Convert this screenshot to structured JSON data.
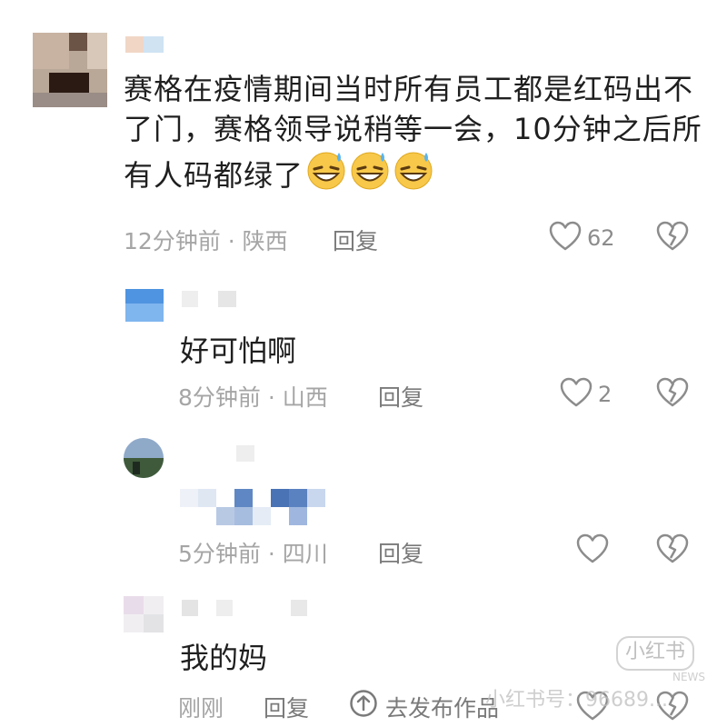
{
  "comments": [
    {
      "text": "赛格在疫情期间当时所有员工都是红码出不了门，赛格领导说稍等一会，10分钟之后所有人码都绿了",
      "emoji": [
        "grinning-sweat-emoji",
        "grinning-sweat-emoji",
        "grinning-sweat-emoji"
      ],
      "time_location": "12分钟前 · 陕西",
      "reply_label": "回复",
      "like_count": "62"
    },
    {
      "text": "好可怕啊",
      "time_location": "8分钟前 · 山西",
      "reply_label": "回复",
      "like_count": "2"
    },
    {
      "text": "",
      "time_location": "5分钟前 · 四川",
      "reply_label": "回复",
      "like_count": ""
    },
    {
      "text": "我的妈",
      "time_location": "刚刚",
      "reply_label": "回复",
      "upload_label": "去发布作品",
      "like_count": ""
    }
  ],
  "watermark": {
    "logo": "小红书",
    "id_text": "小红书号：96689...",
    "small": "NEWS"
  },
  "colors": {
    "text": "#1f1f1f",
    "meta": "#a5a5a5",
    "icon": "#8c8c8c"
  }
}
